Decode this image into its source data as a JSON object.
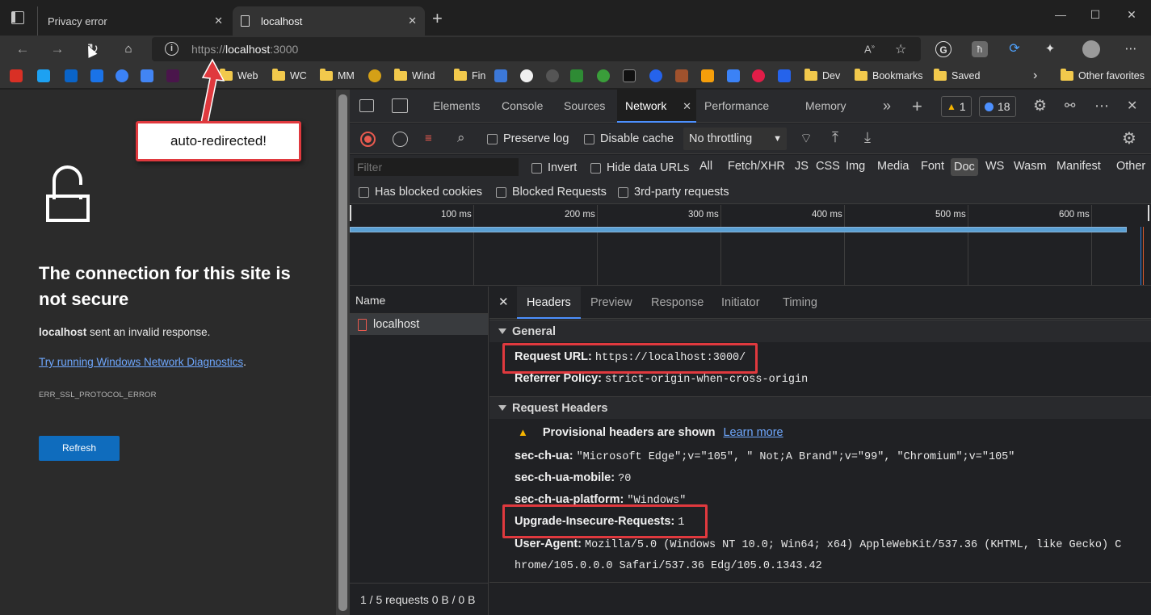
{
  "browser": {
    "tabs": [
      {
        "title": "Privacy error"
      },
      {
        "title": "localhost"
      }
    ],
    "new_tab_label": "+",
    "window_controls": {
      "minimize": "—",
      "maximize": "☐",
      "close": "✕"
    },
    "address": {
      "scheme": "https://",
      "host": "localhost",
      "port": ":3000"
    },
    "favorites": [
      {
        "label": "Web"
      },
      {
        "label": "WC"
      },
      {
        "label": "MM"
      },
      {
        "label": "Wind"
      },
      {
        "label": "Fin"
      },
      {
        "label": "Dev"
      },
      {
        "label": "Bookmarks"
      },
      {
        "label": "Saved"
      },
      {
        "label": "Other favorites"
      }
    ]
  },
  "error_page": {
    "title": "The connection for this site is not secure",
    "host": "localhost",
    "message": " sent an invalid response.",
    "link": "Try running Windows Network Diagnostics",
    "link_suffix": ".",
    "code": "ERR_SSL_PROTOCOL_ERROR",
    "refresh_label": "Refresh"
  },
  "annotation": {
    "callout": "auto-redirected!",
    "accent_color": "#e0393e"
  },
  "devtools": {
    "tabs": [
      "Elements",
      "Console",
      "Sources",
      "Network",
      "Performance",
      "Memory"
    ],
    "active_tab": "Network",
    "warnings_count": "1",
    "messages_count": "18",
    "toolbar": {
      "preserve_log": "Preserve log",
      "disable_cache": "Disable cache",
      "throttling": "No throttling"
    },
    "filter_placeholder": "Filter",
    "filter_options": {
      "invert": "Invert",
      "hide_data_urls": "Hide data URLs"
    },
    "resource_types": [
      "All",
      "Fetch/XHR",
      "JS",
      "CSS",
      "Img",
      "Media",
      "Font",
      "Doc",
      "WS",
      "Wasm",
      "Manifest",
      "Other"
    ],
    "selected_type": "Doc",
    "filter_row2": [
      "Has blocked cookies",
      "Blocked Requests",
      "3rd-party requests"
    ],
    "timeline_ticks": [
      "100 ms",
      "200 ms",
      "300 ms",
      "400 ms",
      "500 ms",
      "600 ms"
    ],
    "request_list": {
      "header": "Name",
      "rows": [
        "localhost"
      ],
      "footer": "1 / 5 requests  0 B / 0 B"
    },
    "detail_tabs": [
      "Headers",
      "Preview",
      "Response",
      "Initiator",
      "Timing"
    ],
    "active_detail_tab": "Headers",
    "general": {
      "title": "General",
      "request_url_key": "Request URL",
      "request_url": "https://localhost:3000/",
      "referrer_key": "Referrer Policy",
      "referrer": "strict-origin-when-cross-origin"
    },
    "request_headers": {
      "title": "Request Headers",
      "warning": "Provisional headers are shown",
      "learn_more": "Learn more",
      "items": [
        {
          "k": "sec-ch-ua",
          "v": "\"Microsoft Edge\";v=\"105\", \" Not;A Brand\";v=\"99\", \"Chromium\";v=\"105\""
        },
        {
          "k": "sec-ch-ua-mobile",
          "v": "?0"
        },
        {
          "k": "sec-ch-ua-platform",
          "v": "\"Windows\""
        },
        {
          "k": "Upgrade-Insecure-Requests",
          "v": "1"
        },
        {
          "k": "User-Agent",
          "v": "Mozilla/5.0 (Windows NT 10.0; Win64; x64) AppleWebKit/537.36 (KHTML, like Gecko) C"
        }
      ],
      "user_agent_cont": "hrome/105.0.0.0 Safari/537.36 Edg/105.0.1343.42"
    }
  }
}
